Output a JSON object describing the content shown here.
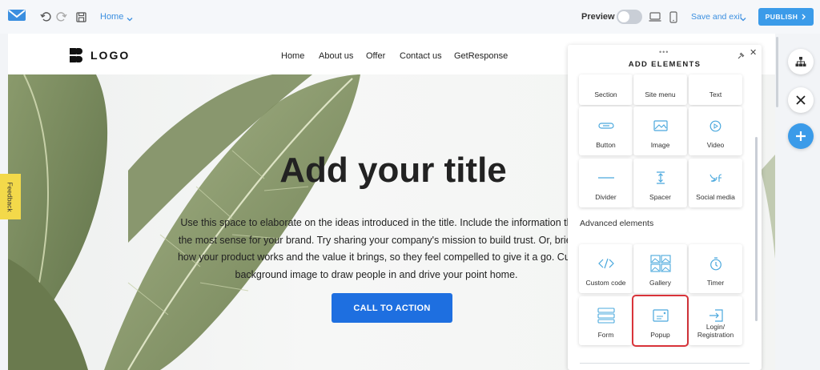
{
  "toolbar": {
    "page_selector": "Home",
    "preview_label": "Preview",
    "save_exit_label": "Save and exit",
    "publish_label": "PUBLISH"
  },
  "site": {
    "logo_text": "LOGO",
    "nav": [
      "Home",
      "About us",
      "Offer",
      "Contact us",
      "GetResponse"
    ]
  },
  "hero": {
    "title": "Add your title",
    "body_lines": [
      "Use this space to elaborate on the ideas introduced in the title. Include the information th",
      "the most sense for your brand. Try sharing your company's mission to build trust. Or, brief",
      "how your product works and the value it brings, so they feel compelled to give it a go. Cus",
      "background image to draw people in and drive your point home."
    ],
    "cta_label": "CALL TO ACTION"
  },
  "feedback_label": "Feedback",
  "panel": {
    "title": "ADD ELEMENTS",
    "basic": [
      {
        "label": "Section",
        "icon": "section-icon"
      },
      {
        "label": "Site menu",
        "icon": "site-menu-icon"
      },
      {
        "label": "Text",
        "icon": "text-icon"
      },
      {
        "label": "Button",
        "icon": "button-icon"
      },
      {
        "label": "Image",
        "icon": "image-icon"
      },
      {
        "label": "Video",
        "icon": "video-icon"
      },
      {
        "label": "Divider",
        "icon": "divider-icon"
      },
      {
        "label": "Spacer",
        "icon": "spacer-icon"
      },
      {
        "label": "Social media",
        "icon": "social-media-icon"
      }
    ],
    "advanced_heading": "Advanced elements",
    "advanced": [
      {
        "label": "Custom code",
        "icon": "code-icon"
      },
      {
        "label": "Gallery",
        "icon": "gallery-icon"
      },
      {
        "label": "Timer",
        "icon": "timer-icon"
      },
      {
        "label": "Form",
        "icon": "form-icon"
      },
      {
        "label": "Popup",
        "icon": "popup-icon",
        "highlighted": true
      },
      {
        "label": "Login/\nRegistration",
        "icon": "login-icon"
      }
    ]
  },
  "colors": {
    "accent": "#3b9be9",
    "cta": "#1e6fe0",
    "highlight": "#d9343a",
    "feedback": "#f3d94a",
    "icon": "#4aa8dd"
  }
}
